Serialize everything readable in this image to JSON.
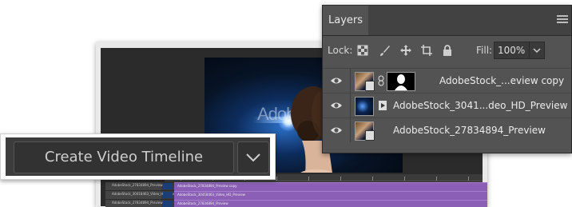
{
  "editor": {
    "watermark_text": "Adobe",
    "timeline_tracks": [
      {
        "label": "AdobeStock_27834894_Preview copy",
        "clip": "AdobeStock_27834894_Preview copy"
      },
      {
        "label": "AdobeStock_30418463_Video_HD_Preview",
        "clip": "AdobeStock_30418463_Video_HD_Preview"
      },
      {
        "label": "AdobeStock_27834894_Preview",
        "clip": "AdobeStock_27834894_Preview"
      }
    ]
  },
  "timeline_button": {
    "label": "Create Video Timeline",
    "dropdown_icon": "chevron-down-icon"
  },
  "layers_panel": {
    "tab_label": "Layers",
    "menu_icon": "hamburger-menu-icon",
    "lock_label": "Lock:",
    "lock_icons": [
      "lock-transparent-pixels-icon",
      "lock-image-pixels-icon",
      "lock-position-icon",
      "lock-artboard-icon",
      "lock-all-icon"
    ],
    "fill_label": "Fill:",
    "fill_value": "100%",
    "layers": [
      {
        "name": "AdobeStock_...eview copy",
        "visible": true,
        "has_mask": true,
        "smart_object": true
      },
      {
        "name": "AdobeStock_3041...deo_HD_Preview",
        "visible": true,
        "has_mask": false,
        "video": true
      },
      {
        "name": "AdobeStock_27834894_Preview",
        "visible": true,
        "has_mask": false,
        "smart_object": true
      }
    ]
  },
  "colors": {
    "panel_bg": "#535353",
    "tab_bar_bg": "#424242",
    "clip_purple": "#8a5fb5",
    "button_bg": "#323232"
  }
}
